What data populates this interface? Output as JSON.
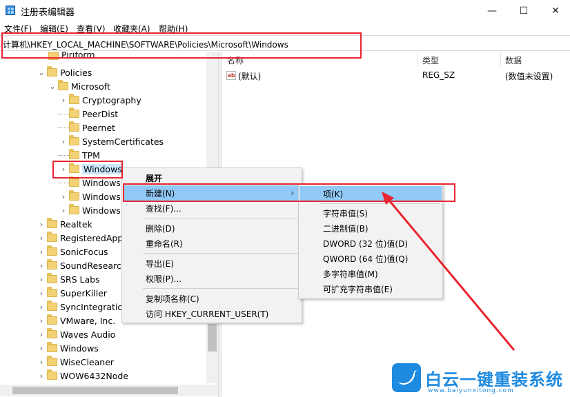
{
  "window": {
    "title": "注册表编辑器",
    "controls": {
      "minimize": "—",
      "maximize": "☐",
      "close": "✕"
    }
  },
  "menubar": [
    "文件(F)",
    "编辑(E)",
    "查看(V)",
    "收藏夹(A)",
    "帮助(H)"
  ],
  "address": "计算机\\HKEY_LOCAL_MACHINE\\SOFTWARE\\Policies\\Microsoft\\Windows",
  "tree": {
    "partial_top": "Piriform",
    "items": [
      "Policies",
      "Microsoft",
      "Cryptography",
      "PeerDist",
      "Peernet",
      "SystemCertificates",
      "TPM",
      "Windows",
      "Windows",
      "Windows",
      "Windows",
      "Realtek",
      "RegisteredApp",
      "SonicFocus",
      "SoundResearch",
      "SRS Labs",
      "SuperKiller",
      "SyncIntegration",
      "VMware, Inc.",
      "Waves Audio",
      "Windows",
      "WiseCleaner",
      "WOW6432Node"
    ]
  },
  "values": {
    "headers": {
      "name": "名称",
      "type": "类型",
      "data": "数据"
    },
    "rows": [
      {
        "name": "(默认)",
        "type": "REG_SZ",
        "data": "(数值未设置)"
      }
    ]
  },
  "context_menu": {
    "items": [
      "展开",
      "新建(N)",
      "查找(F)...",
      "删除(D)",
      "重命名(R)",
      "导出(E)",
      "权限(P)...",
      "复制项名称(C)",
      "访问 HKEY_CURRENT_USER(T)"
    ],
    "arrow": "›"
  },
  "submenu": {
    "items": [
      "项(K)",
      "字符串值(S)",
      "二进制值(B)",
      "DWORD (32 位)值(D)",
      "QWORD (64 位)值(Q)",
      "多字符串值(M)",
      "可扩充字符串值(E)"
    ]
  },
  "watermark": {
    "brand": "白云一键重装系统",
    "url": "www.baiyunxitong.com"
  },
  "colors": {
    "highlight": "#91c9f7",
    "selection": "#cce8ff",
    "annotation": "#e8242f",
    "brand": "#1e8ae0"
  }
}
